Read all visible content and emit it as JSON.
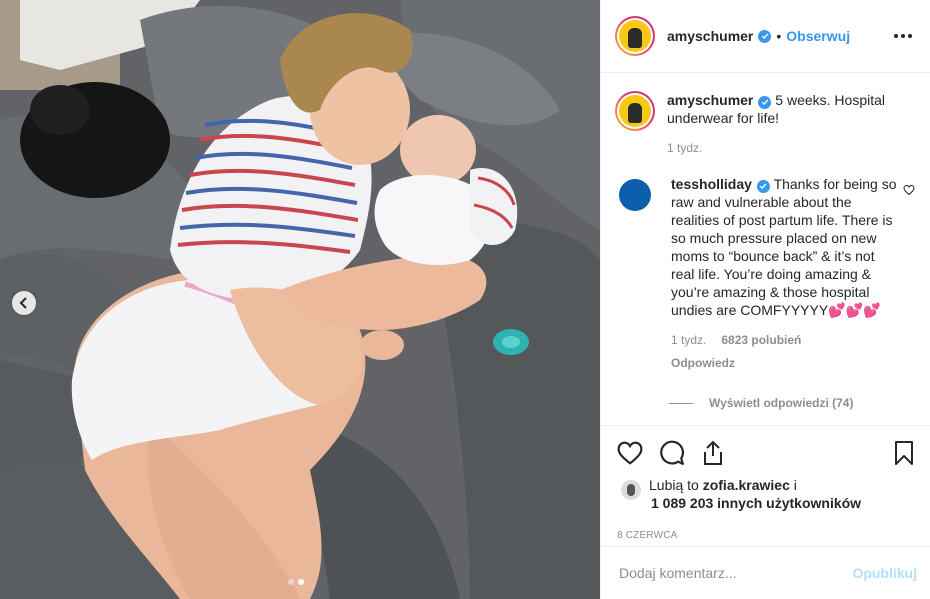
{
  "post": {
    "username": "amyschumer",
    "follow_label": "Obserwuj",
    "bullet": "•",
    "caption_text": "5 weeks. Hospital underwear for life!",
    "caption_time": "1 tydz."
  },
  "comment": {
    "username": "tessholliday",
    "text": "Thanks for being so raw and vulnerable about the realities of post partum life. There is so much pressure placed on new moms to “bounce back” & it’s not real life. You’re doing amazing & you’re amazing & those hospital undies are COMFYYYYY💕💕💕",
    "time": "1 tydz.",
    "likes": "6823 polubień",
    "reply_label": "Odpowiedz",
    "view_replies": "Wyświetl odpowiedzi (74)"
  },
  "likes": {
    "prefix": "Lubią to",
    "user": "zofia.krawiec",
    "joiner": "i",
    "others": "1 089 203 innych użytkowników"
  },
  "date": "8 CZERWCA",
  "comment_input": {
    "placeholder": "Dodaj komentarz...",
    "publish_label": "Opublikuj"
  },
  "carousel": {
    "count": 2,
    "active": 2
  },
  "colors": {
    "accent": "#3897f0",
    "publish_disabled": "#b2dffc",
    "meta_gray": "#8e8e8e"
  },
  "icons": [
    "heart-icon",
    "comment-icon",
    "share-icon",
    "bookmark-icon",
    "chevron-left-icon",
    "verified-badge-icon",
    "more-options-icon"
  ]
}
